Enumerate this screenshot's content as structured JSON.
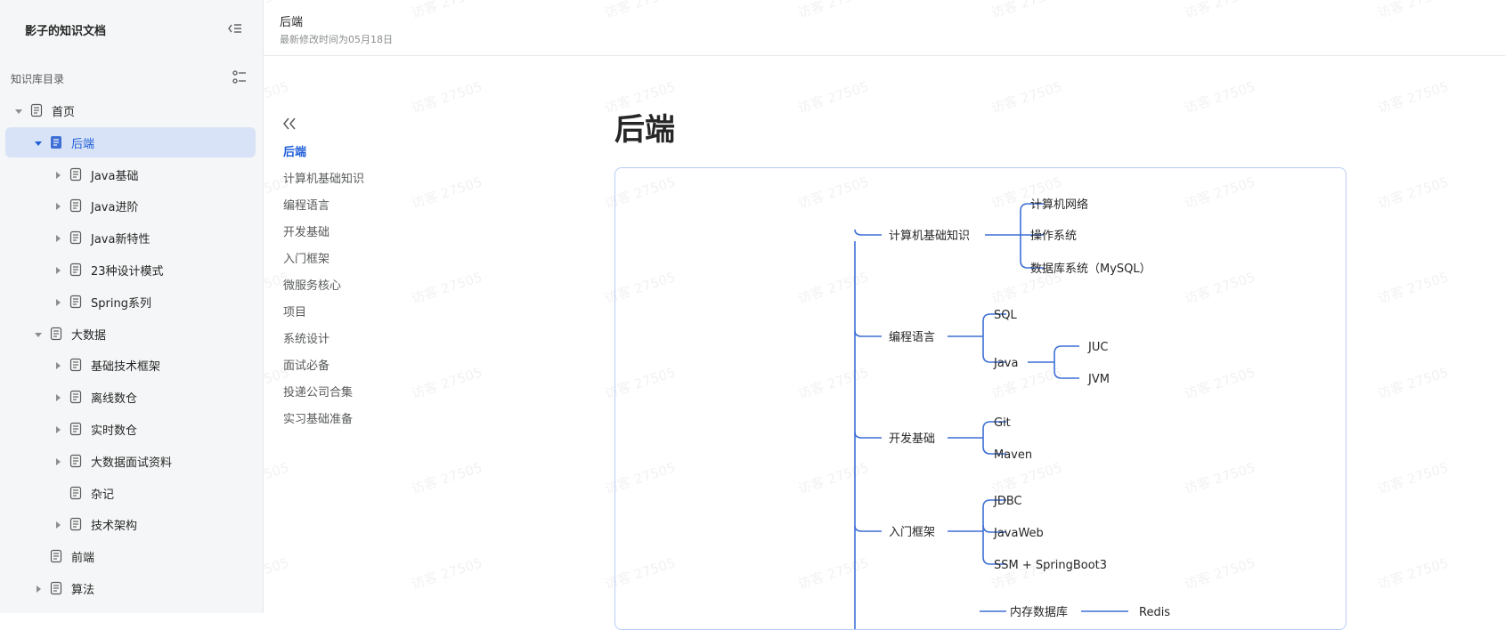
{
  "sidebar": {
    "kb_title": "影子的知识文档",
    "dir_label": "知识库目录",
    "items": [
      {
        "label": "首页",
        "level": 0,
        "caret": "down",
        "active": false
      },
      {
        "label": "后端",
        "level": 1,
        "caret": "down",
        "active": true
      },
      {
        "label": "Java基础",
        "level": 2,
        "caret": "right",
        "active": false
      },
      {
        "label": "Java进阶",
        "level": 2,
        "caret": "right",
        "active": false
      },
      {
        "label": "Java新特性",
        "level": 2,
        "caret": "right",
        "active": false
      },
      {
        "label": "23种设计模式",
        "level": 2,
        "caret": "right",
        "active": false
      },
      {
        "label": "Spring系列",
        "level": 2,
        "caret": "right",
        "active": false
      },
      {
        "label": "大数据",
        "level": 1,
        "caret": "down",
        "active": false
      },
      {
        "label": "基础技术框架",
        "level": 2,
        "caret": "right",
        "active": false
      },
      {
        "label": "离线数仓",
        "level": 2,
        "caret": "right",
        "active": false
      },
      {
        "label": "实时数仓",
        "level": 2,
        "caret": "right",
        "active": false
      },
      {
        "label": "大数据面试资料",
        "level": 2,
        "caret": "right",
        "active": false
      },
      {
        "label": "杂记",
        "level": 2,
        "caret": "none",
        "active": false
      },
      {
        "label": "技术架构",
        "level": 2,
        "caret": "right",
        "active": false
      },
      {
        "label": "前端",
        "level": 1,
        "caret": "none",
        "active": false
      },
      {
        "label": "算法",
        "level": 1,
        "caret": "right",
        "active": false
      }
    ]
  },
  "header": {
    "title": "后端",
    "meta": "最新修改时间为05月18日"
  },
  "toc": {
    "items": [
      {
        "label": "后端",
        "active": true
      },
      {
        "label": "计算机基础知识",
        "active": false
      },
      {
        "label": "编程语言",
        "active": false
      },
      {
        "label": "开发基础",
        "active": false
      },
      {
        "label": "入门框架",
        "active": false
      },
      {
        "label": "微服务核心",
        "active": false
      },
      {
        "label": "项目",
        "active": false
      },
      {
        "label": "系统设计",
        "active": false
      },
      {
        "label": "面试必备",
        "active": false
      },
      {
        "label": "投递公司合集",
        "active": false
      },
      {
        "label": "实习基础准备",
        "active": false
      }
    ]
  },
  "content": {
    "title": "后端",
    "mindmap": {
      "branches": [
        {
          "label": "计算机基础知识",
          "children": [
            {
              "label": "计算机网络"
            },
            {
              "label": "操作系统"
            },
            {
              "label": "数据库系统（MySQL）"
            }
          ]
        },
        {
          "label": "编程语言",
          "children": [
            {
              "label": "SQL"
            },
            {
              "label": "Java",
              "children": [
                {
                  "label": "JUC"
                },
                {
                  "label": "JVM"
                }
              ]
            }
          ]
        },
        {
          "label": "开发基础",
          "children": [
            {
              "label": "Git"
            },
            {
              "label": "Maven"
            }
          ]
        },
        {
          "label": "入门框架",
          "children": [
            {
              "label": "JDBC"
            },
            {
              "label": "JavaWeb"
            },
            {
              "label": "SSM + SpringBoot3"
            }
          ]
        },
        {
          "label": "内存数据库",
          "children": [
            {
              "label": "Redis"
            }
          ]
        }
      ]
    }
  },
  "watermark": {
    "text": "访客 27505"
  },
  "icons": {
    "collapse": "sidebar-collapse-icon",
    "directory": "list-view-icon",
    "doc": "document-icon",
    "caret": "caret-icon",
    "toc_back": "double-chevron-left-icon"
  },
  "colors": {
    "accent": "#1f5fd8",
    "active_bg": "#d9e3f7",
    "mindmap_line": "#3d6fd6",
    "mindmap_border": "#b8ccf5"
  }
}
